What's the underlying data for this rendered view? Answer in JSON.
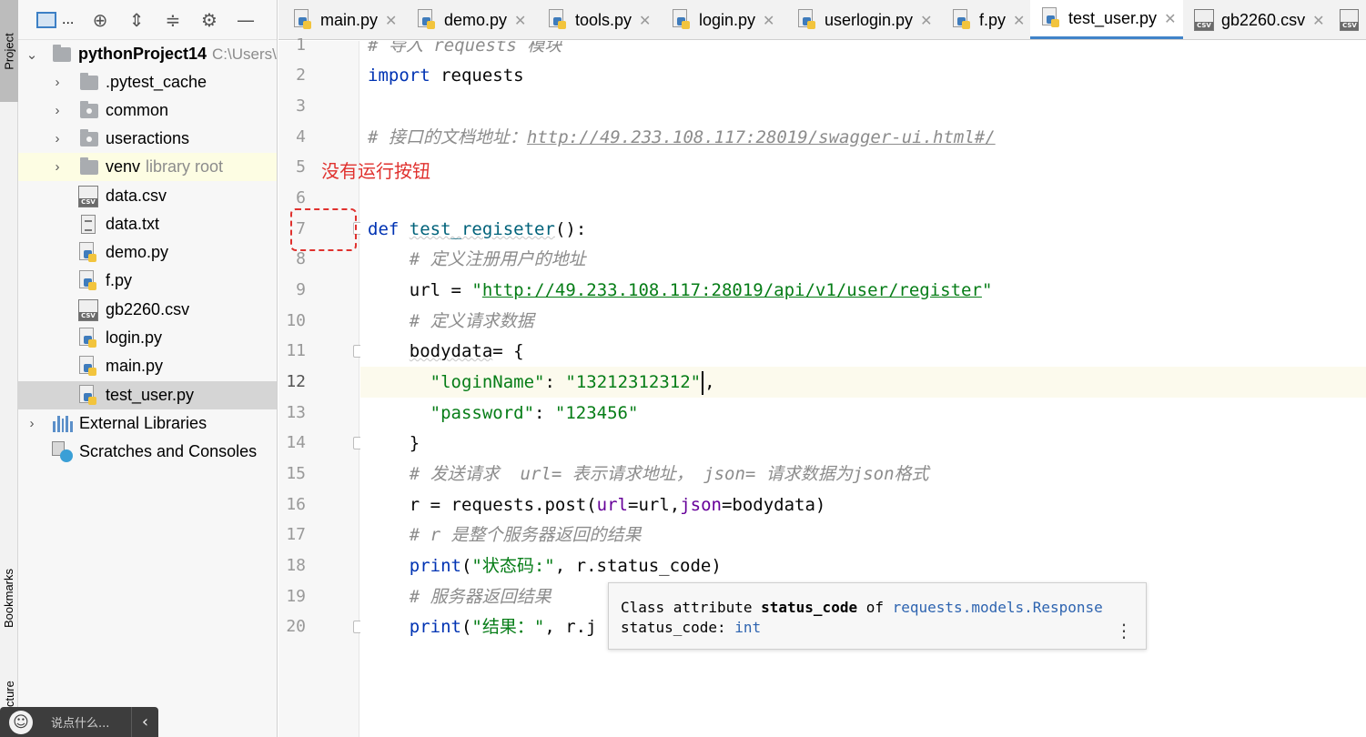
{
  "tool_strip": {
    "project": "Project",
    "bookmarks": "Bookmarks",
    "structure": "Structure"
  },
  "project_panel": {
    "title": "...",
    "tree": [
      {
        "label": "pythonProject14",
        "hint": "C:\\Users\\",
        "kind": "root-folder",
        "expanded": true
      },
      {
        "label": ".pytest_cache",
        "kind": "folder"
      },
      {
        "label": "common",
        "kind": "package"
      },
      {
        "label": "useractions",
        "kind": "package"
      },
      {
        "label": "venv",
        "hint": "library root",
        "kind": "folder"
      },
      {
        "label": "data.csv",
        "kind": "csv"
      },
      {
        "label": "data.txt",
        "kind": "txt"
      },
      {
        "label": "demo.py",
        "kind": "python"
      },
      {
        "label": "f.py",
        "kind": "python"
      },
      {
        "label": "gb2260.csv",
        "kind": "csv"
      },
      {
        "label": "login.py",
        "kind": "python"
      },
      {
        "label": "main.py",
        "kind": "python"
      },
      {
        "label": "test_user.py",
        "kind": "python",
        "selected": true
      },
      {
        "label": "External Libraries",
        "kind": "libraries"
      },
      {
        "label": "Scratches and Consoles",
        "kind": "scratches"
      }
    ]
  },
  "tabs": [
    {
      "label": "main.py",
      "icon": "python-file-icon"
    },
    {
      "label": "demo.py",
      "icon": "python-file-icon"
    },
    {
      "label": "tools.py",
      "icon": "python-file-icon"
    },
    {
      "label": "login.py",
      "icon": "python-file-icon"
    },
    {
      "label": "userlogin.py",
      "icon": "python-file-icon"
    },
    {
      "label": "f.py",
      "icon": "python-file-icon"
    },
    {
      "label": "test_user.py",
      "icon": "python-file-icon",
      "active": true
    },
    {
      "label": "gb2260.csv",
      "icon": "csv-file-icon"
    }
  ],
  "editor": {
    "line_numbers": [
      "1",
      "2",
      "3",
      "4",
      "5",
      "6",
      "7",
      "8",
      "9",
      "10",
      "11",
      "12",
      "13",
      "14",
      "15",
      "16",
      "17",
      "18",
      "19",
      "20"
    ],
    "current_line": "12",
    "code": {
      "l1_comment": "# 导入 requests 模块",
      "l2_kw": "import",
      "l2_rest": " requests",
      "l4_comment": "# 接口的文档地址：",
      "l4_link": "http://49.233.108.117:28019/swagger-ui.html#/",
      "l7_kw": "def",
      "l7_fn": "test_regiseter",
      "l7_rest": "():",
      "l8_comment": "# 定义注册用户的地址",
      "l9_pre": "url = ",
      "l9_q1": "\"",
      "l9_str": "http://49.233.108.117:28019/api/v1/user/register",
      "l9_q2": "\"",
      "l10_comment": "# 定义请求数据",
      "l11_var": "bodydata",
      "l11_rest": "= {",
      "l12_key": "\"loginName\"",
      "l12_mid": ": ",
      "l12_val": "\"13212312312\"",
      "l12_end": ",",
      "l13_key": "\"password\"",
      "l13_mid": ": ",
      "l13_val": "\"123456\"",
      "l14": "}",
      "l15_comment": "# 发送请求  url= 表示请求地址， json= 请求数据为json格式",
      "l16_pre": "r = requests.post(",
      "l16_p1": "url",
      "l16_mid": "=url,",
      "l16_p2": "json",
      "l16_end": "=bodydata)",
      "l17_comment": "# r 是整个服务器返回的结果",
      "l18_fn": "print",
      "l18_open": "(",
      "l18_str": "\"状态码:\"",
      "l18_rest": ", r.status_code)",
      "l19_comment": "# 服务器返回结果",
      "l20_fn": "print",
      "l20_open": "(",
      "l20_str": "\"结果：\"",
      "l20_rest": ", r.j"
    }
  },
  "annotation": {
    "text": "没有运行按钮",
    "color": "#e0312e"
  },
  "tooltip": {
    "prefix": "Class attribute ",
    "name": "status_code",
    "of": " of ",
    "link": "requests.models.Response",
    "type_label": "status_code: ",
    "type_value": "int"
  },
  "chat": {
    "placeholder": "说点什么...",
    "collapse": "‹"
  },
  "colors": {
    "accent": "#4083c9",
    "keyword": "#0033b3",
    "string": "#067d17",
    "comment": "#8c8c8c",
    "annotation": "#e0312e"
  }
}
